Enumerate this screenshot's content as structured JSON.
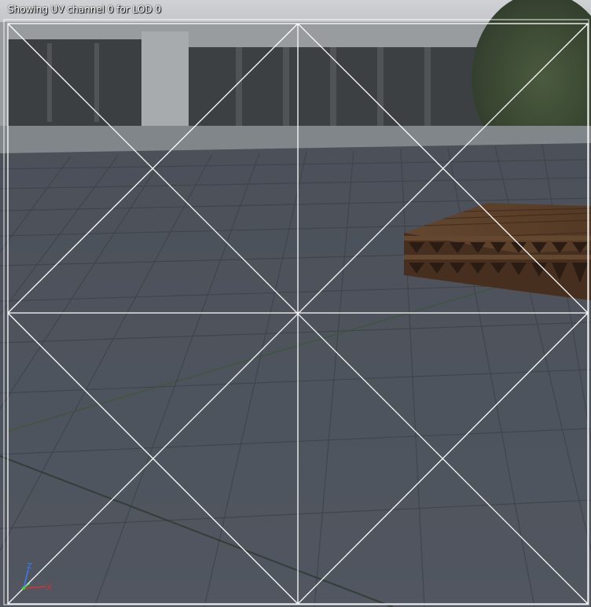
{
  "viewport": {
    "status_text": "Showing UV channel 0 for LOD 0",
    "uv_channel": 0,
    "lod": 0
  },
  "axis_gizmo": {
    "z_label": "Z",
    "x_label": "X",
    "z_color": "#3a7bff",
    "x_color": "#e03030",
    "y_color": "#40d040"
  },
  "colors": {
    "uv_line": "#ffffff",
    "floor": "#4a505b",
    "grid_line": "#3c414a",
    "sky_building": "#9aa0a4",
    "pallet_wood": "#5a3a24"
  },
  "icons": {
    "axis_gizmo": "axis-gizmo-icon"
  }
}
